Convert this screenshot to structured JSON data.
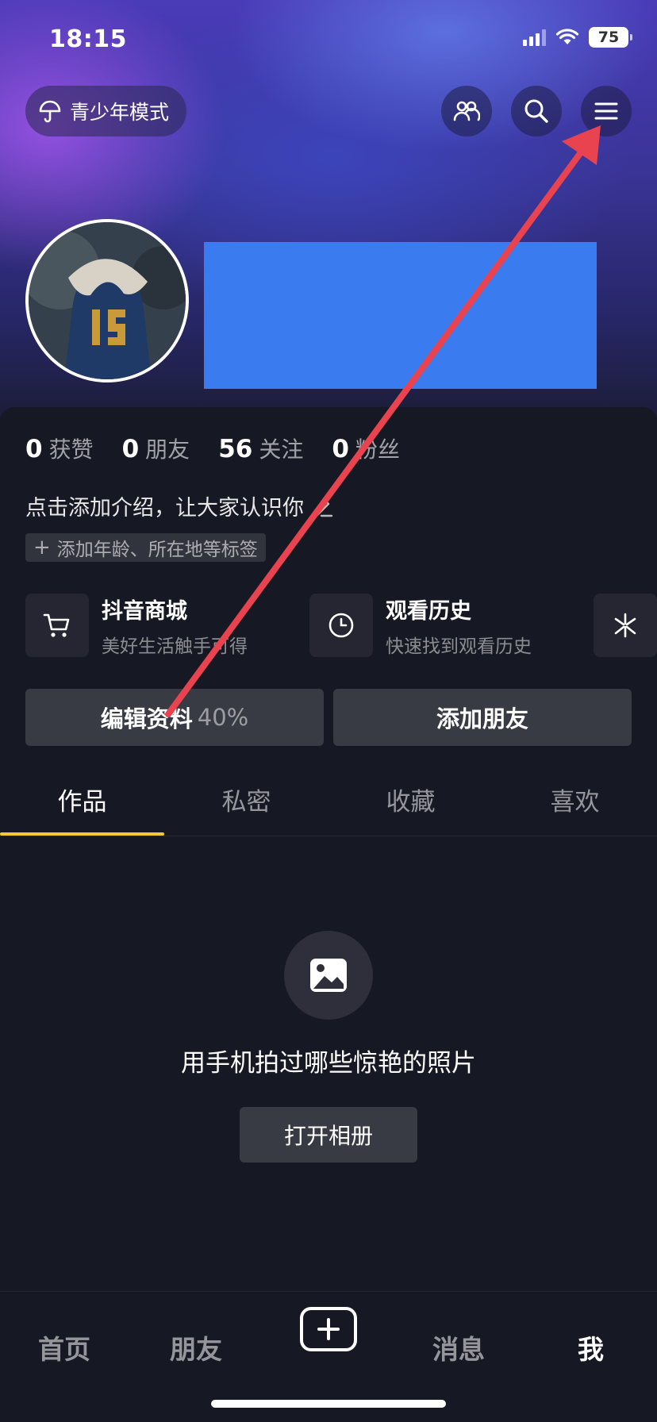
{
  "status_bar": {
    "time": "18:15",
    "battery": "75"
  },
  "header": {
    "teen_mode_label": "青少年模式"
  },
  "stats": [
    {
      "num": "0",
      "label": "获赞"
    },
    {
      "num": "0",
      "label": "朋友"
    },
    {
      "num": "56",
      "label": "关注"
    },
    {
      "num": "0",
      "label": "粉丝"
    }
  ],
  "profile": {
    "bio_prompt": "点击添加介绍，让大家认识你",
    "tag_prompt": "添加年龄、所在地等标签"
  },
  "cards": [
    {
      "title": "抖音商城",
      "subtitle": "美好生活触手可得",
      "icon": "cart-icon"
    },
    {
      "title": "观看历史",
      "subtitle": "快速找到观看历史",
      "icon": "clock-icon"
    }
  ],
  "actions": {
    "edit_label": "编辑资料",
    "edit_percent": "40%",
    "add_friend_label": "添加朋友"
  },
  "tabs": [
    "作品",
    "私密",
    "收藏",
    "喜欢"
  ],
  "empty_state": {
    "text": "用手机拍过哪些惊艳的照片",
    "button_label": "打开相册"
  },
  "bottom_nav": [
    "首页",
    "朋友",
    "消息",
    "我"
  ],
  "colors": {
    "background": "#161823",
    "accent_tab": "#f7c631",
    "name_block": "#3a7bef",
    "annotation_arrow": "#e8434f"
  }
}
